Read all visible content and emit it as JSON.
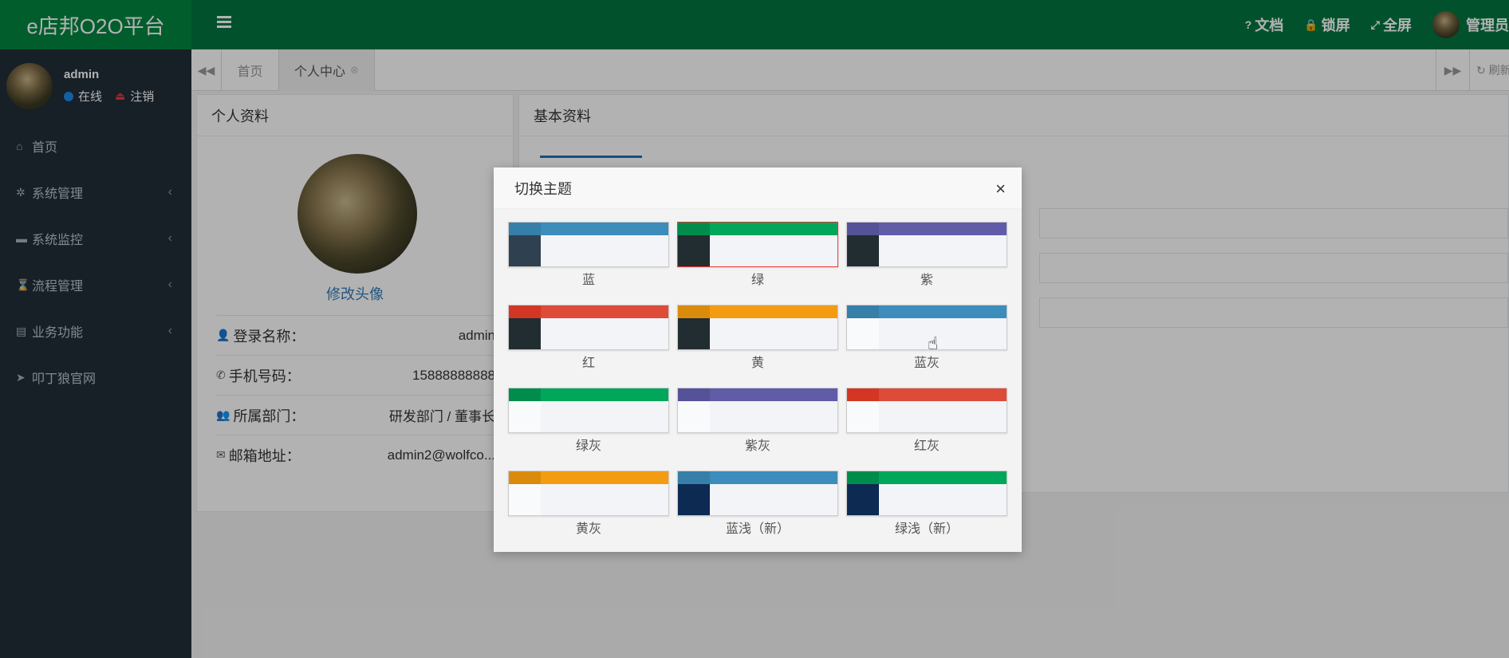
{
  "app": {
    "title": "e店邦O2O平台"
  },
  "user": {
    "name": "admin",
    "status": "在线",
    "logout": "注销"
  },
  "sidebar": {
    "items": [
      {
        "icon": "home-icon",
        "glyph": "⌂",
        "label": "首页",
        "has_children": false
      },
      {
        "icon": "gear-icon",
        "glyph": "✲",
        "label": "系统管理",
        "has_children": true
      },
      {
        "icon": "video-icon",
        "glyph": "▬",
        "label": "系统监控",
        "has_children": true
      },
      {
        "icon": "hourglass-icon",
        "glyph": "⌛",
        "label": "流程管理",
        "has_children": true
      },
      {
        "icon": "newspaper-icon",
        "glyph": "▤",
        "label": "业务功能",
        "has_children": true
      },
      {
        "icon": "send-icon",
        "glyph": "➤",
        "label": "叩丁狼官网",
        "has_children": false
      }
    ]
  },
  "header": {
    "docs": "文档",
    "lock": "锁屏",
    "fullscreen": "全屏",
    "admin": "管理员"
  },
  "tabs": {
    "home": "首页",
    "active": "个人中心",
    "refresh": "刷新"
  },
  "profile": {
    "title": "个人资料",
    "change_avatar": "修改头像",
    "rows": [
      {
        "icon": "user-icon",
        "glyph": "👤",
        "label": "登录名称：",
        "value": "admin"
      },
      {
        "icon": "phone-icon",
        "glyph": "✆",
        "label": "手机号码：",
        "value": "15888888888"
      },
      {
        "icon": "users-icon",
        "glyph": "👥",
        "label": "所属部门：",
        "value": "研发部门 / 董事长"
      },
      {
        "icon": "envelope-icon",
        "glyph": "✉",
        "label": "邮箱地址：",
        "value": "admin2@wolfco..."
      }
    ]
  },
  "basic": {
    "title": "基本资料"
  },
  "modal": {
    "title": "切换主题",
    "close": "×",
    "selected": "绿",
    "themes": [
      {
        "label": "蓝",
        "logo": "#367fa9",
        "head": "#3c8dbc",
        "side": "#2f4050"
      },
      {
        "label": "绿",
        "logo": "#008d4c",
        "head": "#00a65a",
        "side": "#222d32"
      },
      {
        "label": "紫",
        "logo": "#555299",
        "head": "#605ca8",
        "side": "#222d32"
      },
      {
        "label": "红",
        "logo": "#d33724",
        "head": "#dd4b39",
        "side": "#222d32"
      },
      {
        "label": "黄",
        "logo": "#db8b0b",
        "head": "#f39c12",
        "side": "#222d32"
      },
      {
        "label": "蓝灰",
        "logo": "#367fa9",
        "head": "#3c8dbc",
        "side": "#f9fafc"
      },
      {
        "label": "绿灰",
        "logo": "#008d4c",
        "head": "#00a65a",
        "side": "#f9fafc"
      },
      {
        "label": "紫灰",
        "logo": "#555299",
        "head": "#605ca8",
        "side": "#f9fafc"
      },
      {
        "label": "红灰",
        "logo": "#d33724",
        "head": "#dd4b39",
        "side": "#f9fafc"
      },
      {
        "label": "黄灰",
        "logo": "#db8b0b",
        "head": "#f39c12",
        "side": "#f9fafc"
      },
      {
        "label": "蓝浅（新）",
        "logo": "#367fa9",
        "head": "#3c8dbc",
        "side": "#0c2a52"
      },
      {
        "label": "绿浅（新）",
        "logo": "#008d4c",
        "head": "#00a65a",
        "side": "#0c2a52"
      }
    ]
  }
}
